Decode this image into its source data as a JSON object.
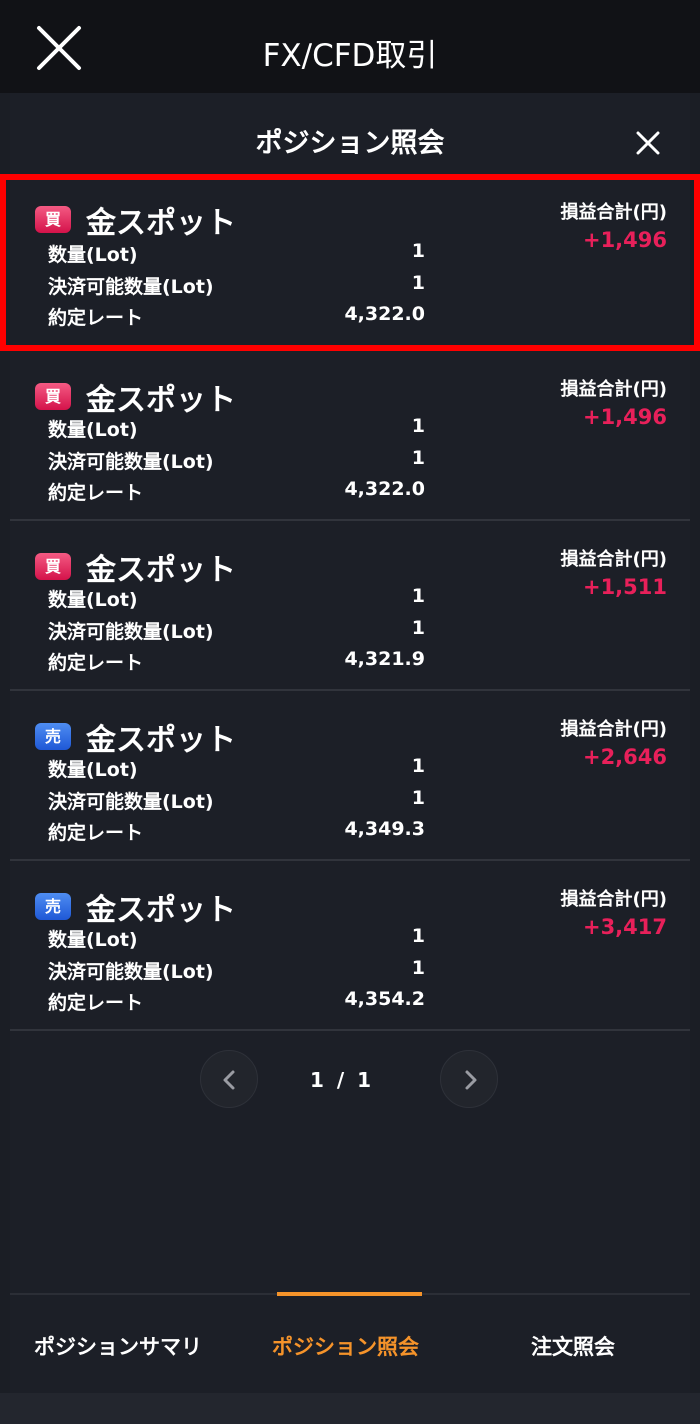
{
  "header": {
    "title": "FX/CFD取引",
    "close_icon": "close-icon"
  },
  "panel": {
    "title": "ポジション照会",
    "close_icon": "close-icon"
  },
  "labels": {
    "quantity": "数量(Lot)",
    "settleable": "決済可能数量(Lot)",
    "rate": "約定レート",
    "pl": "損益合計(円)"
  },
  "positions": [
    {
      "side": "買",
      "side_type": "buy",
      "name": "金スポット",
      "quantity": "1",
      "settleable": "1",
      "rate": "4,322.0",
      "pl": "+1,496"
    },
    {
      "side": "買",
      "side_type": "buy",
      "name": "金スポット",
      "quantity": "1",
      "settleable": "1",
      "rate": "4,322.0",
      "pl": "+1,496"
    },
    {
      "side": "買",
      "side_type": "buy",
      "name": "金スポット",
      "quantity": "1",
      "settleable": "1",
      "rate": "4,321.9",
      "pl": "+1,511"
    },
    {
      "side": "売",
      "side_type": "sell",
      "name": "金スポット",
      "quantity": "1",
      "settleable": "1",
      "rate": "4,349.3",
      "pl": "+2,646"
    },
    {
      "side": "売",
      "side_type": "sell",
      "name": "金スポット",
      "quantity": "1",
      "settleable": "1",
      "rate": "4,354.2",
      "pl": "+3,417"
    }
  ],
  "pager": {
    "current": "1",
    "separator": "/",
    "total": "1"
  },
  "tabs": [
    {
      "label": "ポジションサマリ",
      "active": false
    },
    {
      "label": "ポジション照会",
      "active": true
    },
    {
      "label": "注文照会",
      "active": false
    }
  ],
  "colors": {
    "buy": "#e8205a",
    "sell": "#2f6fe6",
    "accent": "#f5932a",
    "profit": "#e8205a",
    "highlight": "#ff0000"
  }
}
